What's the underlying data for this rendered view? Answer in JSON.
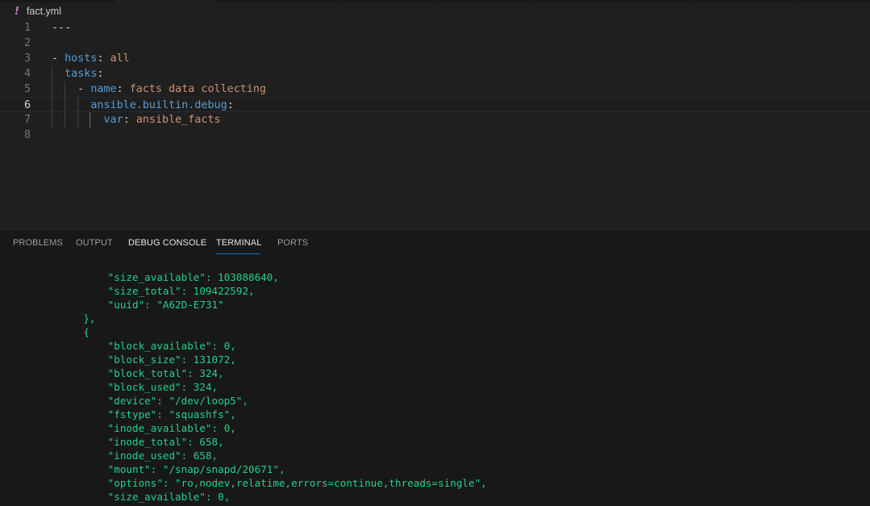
{
  "editor": {
    "filename": "fact.yml",
    "file_icon": "!",
    "lines": [
      {
        "num": "1",
        "tokens": [
          {
            "t": "---",
            "c": "p"
          }
        ]
      },
      {
        "num": "2",
        "tokens": []
      },
      {
        "num": "3",
        "tokens": [
          {
            "t": "- ",
            "c": "p"
          },
          {
            "t": "hosts",
            "c": "k"
          },
          {
            "t": ": ",
            "c": "p"
          },
          {
            "t": "all",
            "c": "s"
          }
        ]
      },
      {
        "num": "4",
        "tokens": [
          {
            "t": "  ",
            "c": "p"
          },
          {
            "t": "tasks",
            "c": "k"
          },
          {
            "t": ":",
            "c": "p"
          }
        ]
      },
      {
        "num": "5",
        "tokens": [
          {
            "t": "    - ",
            "c": "p"
          },
          {
            "t": "name",
            "c": "k"
          },
          {
            "t": ": ",
            "c": "p"
          },
          {
            "t": "facts data collecting",
            "c": "s"
          }
        ]
      },
      {
        "num": "6",
        "tokens": [
          {
            "t": "      ",
            "c": "p"
          },
          {
            "t": "ansible.builtin.debug",
            "c": "k"
          },
          {
            "t": ":",
            "c": "p"
          }
        ]
      },
      {
        "num": "7",
        "tokens": [
          {
            "t": "        ",
            "c": "p"
          },
          {
            "t": "var",
            "c": "k"
          },
          {
            "t": ": ",
            "c": "p"
          },
          {
            "t": "ansible_facts",
            "c": "s"
          }
        ]
      },
      {
        "num": "8",
        "tokens": []
      }
    ],
    "current_line": "6"
  },
  "panel": {
    "tabs": [
      {
        "label": "PROBLEMS",
        "active": false
      },
      {
        "label": "OUTPUT",
        "active": false
      },
      {
        "label": "DEBUG CONSOLE",
        "active": false
      },
      {
        "label": "TERMINAL",
        "active": true
      },
      {
        "label": "PORTS",
        "active": false
      }
    ],
    "terminal_lines": [
      "        \"size_available\": 103088640,",
      "        \"size_total\": 109422592,",
      "        \"uuid\": \"A62D-E731\"",
      "    },",
      "    {",
      "        \"block_available\": 0,",
      "        \"block_size\": 131072,",
      "        \"block_total\": 324,",
      "        \"block_used\": 324,",
      "        \"device\": \"/dev/loop5\",",
      "        \"fstype\": \"squashfs\",",
      "        \"inode_available\": 0,",
      "        \"inode_total\": 658,",
      "        \"inode_used\": 658,",
      "        \"mount\": \"/snap/snapd/20671\",",
      "        \"options\": \"ro,nodev,relatime,errors=continue,threads=single\",",
      "        \"size_available\": 0,"
    ]
  },
  "colors": {
    "keyword": "#569cd6",
    "string": "#ce9178",
    "terminal_text": "#23d18b",
    "active_tab_underline": "#0078d4"
  }
}
